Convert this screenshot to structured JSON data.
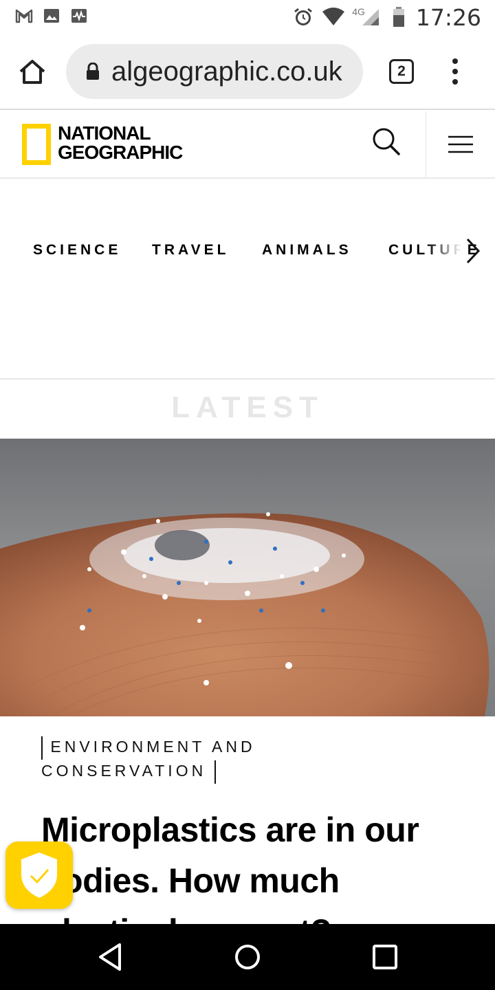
{
  "status_bar": {
    "left_icons": [
      "gmail-icon",
      "image-icon",
      "activity-icon"
    ],
    "right_icons": [
      "alarm-icon",
      "wifi-icon",
      "signal-icon",
      "battery-icon"
    ],
    "network": "4G",
    "time": "17:26"
  },
  "browser": {
    "url": "algeographic.co.uk",
    "tab_count": "2"
  },
  "site": {
    "logo_line1": "NATIONAL",
    "logo_line2": "GEOGRAPHIC",
    "logo_color": "#FFD100",
    "nav": [
      "SCIENCE",
      "TRAVEL",
      "ANIMALS",
      "CULTURE"
    ]
  },
  "section": {
    "title": "LATEST"
  },
  "article": {
    "category": "ENVIRONMENT AND CONSERVATION",
    "headline": "Microplastics are in our bodies. How much plastic do we eat?"
  }
}
